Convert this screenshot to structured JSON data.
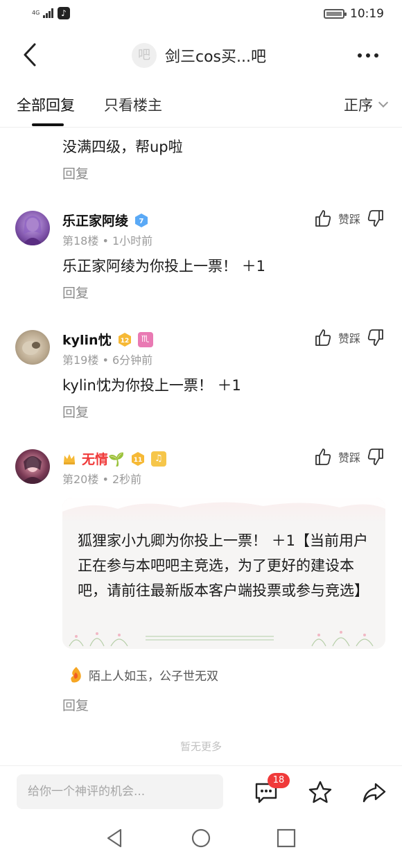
{
  "status_bar": {
    "network": "4G",
    "time": "10:19"
  },
  "header": {
    "title": "剑三cos买...吧",
    "avatar_text": "吧"
  },
  "tabs": {
    "all": "全部回复",
    "host_only": "只看楼主",
    "sort": "正序"
  },
  "partial_post": {
    "content": "没满四级，帮up啦",
    "reply": "回复"
  },
  "posts": [
    {
      "user": "乐正家阿绫",
      "level": "7",
      "floor": "第18楼",
      "time": "1小时前",
      "content": "乐正家阿绫为你投上一票！ ＋1",
      "reply": "回复",
      "like": "赞踩"
    },
    {
      "user": "kylin忱",
      "level": "12",
      "sign_badge": "♏",
      "floor": "第19楼",
      "time": "6分钟前",
      "content": "kylin忱为你投上一票！ ＋1",
      "reply": "回复",
      "like": "赞踩"
    },
    {
      "user": "无情🌱",
      "level": "11",
      "floor": "第20楼",
      "time": "2秒前",
      "content": "狐狸家小九卿为你投上一票！ ＋1【当前用户正在参与本吧吧主竞选，为了更好的建设本吧，请前往最新版本客户端投票或参与竞选】",
      "tail": "陌上人如玉，公子世无双",
      "reply": "回复",
      "like": "赞踩"
    }
  ],
  "footer": {
    "no_more": "暂无更多"
  },
  "bottom_bar": {
    "placeholder": "给你一个神评的机会...",
    "comment_count": "18"
  },
  "colors": {
    "accent_red": "#f03a3a",
    "vip_name": "#f03a3a",
    "level_gold": "#f6b936",
    "level_blue": "#5aa9f6"
  }
}
